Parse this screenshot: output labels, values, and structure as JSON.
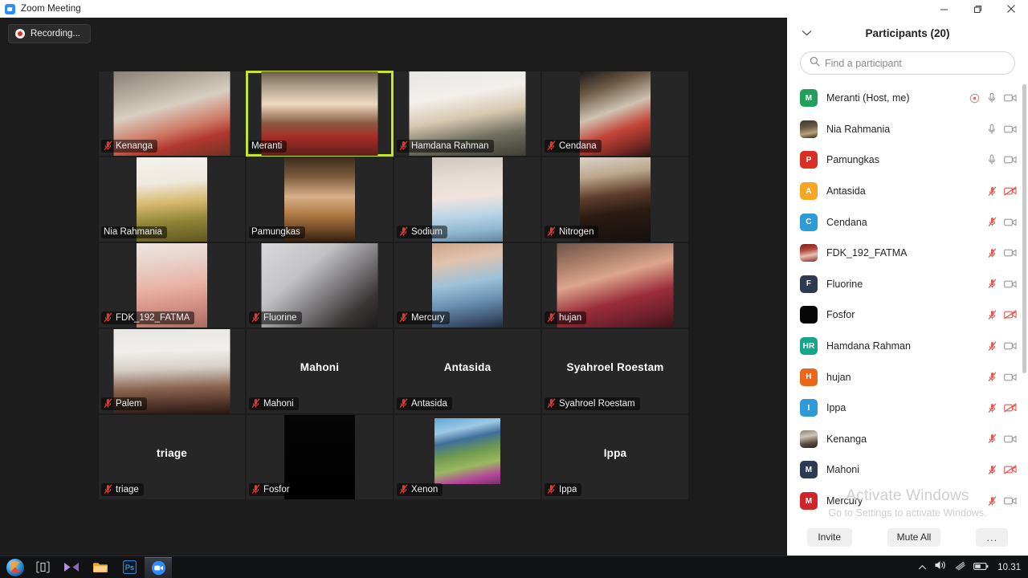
{
  "titlebar": {
    "app_icon": "zoom-icon",
    "title": "Zoom Meeting",
    "minimize": "minimize-icon",
    "restore": "restore-icon",
    "close": "close-icon"
  },
  "meeting": {
    "recording_label": "Recording...",
    "active_speaker": "Meranti",
    "active_border_color": "#c8e629",
    "tiles": [
      {
        "name": "Kenanga",
        "muted": true,
        "video": true,
        "fill": "f-kenanga",
        "media": "wide",
        "label_center": false
      },
      {
        "name": "Meranti",
        "muted": false,
        "video": true,
        "fill": "f-meranti",
        "media": "full",
        "label_center": false,
        "active": true
      },
      {
        "name": "Hamdana Rahman",
        "muted": true,
        "video": true,
        "fill": "f-hamdana",
        "media": "wide",
        "label_center": false
      },
      {
        "name": "Cendana",
        "muted": true,
        "video": true,
        "fill": "f-cendana",
        "media": "normal",
        "label_center": false
      },
      {
        "name": "Nia Rahmania",
        "muted": false,
        "video": true,
        "fill": "f-nia",
        "media": "normal",
        "label_center": false
      },
      {
        "name": "Pamungkas",
        "muted": false,
        "video": true,
        "fill": "f-pamungkas",
        "media": "normal",
        "label_center": false
      },
      {
        "name": "Sodium",
        "muted": true,
        "video": true,
        "fill": "f-sodium",
        "media": "normal",
        "label_center": false
      },
      {
        "name": "Nitrogen",
        "muted": true,
        "video": true,
        "fill": "f-nitrogen",
        "media": "normal",
        "label_center": false
      },
      {
        "name": "FDK_192_FATMA",
        "muted": true,
        "video": true,
        "fill": "f-fatma",
        "media": "normal",
        "label_center": false
      },
      {
        "name": "Fluorine",
        "muted": true,
        "video": true,
        "fill": "f-fluorine",
        "media": "wide",
        "label_center": false
      },
      {
        "name": "Mercury",
        "muted": true,
        "video": true,
        "fill": "f-mercury",
        "media": "normal",
        "label_center": false
      },
      {
        "name": "hujan",
        "muted": true,
        "video": true,
        "fill": "f-hujan",
        "media": "wide",
        "label_center": false
      },
      {
        "name": "Palem",
        "muted": true,
        "video": true,
        "fill": "f-palem",
        "media": "wide",
        "label_center": false
      },
      {
        "name": "Mahoni",
        "muted": true,
        "video": false,
        "fill": "",
        "media": "none",
        "label_center": true
      },
      {
        "name": "Antasida",
        "muted": true,
        "video": false,
        "fill": "",
        "media": "none",
        "label_center": true
      },
      {
        "name": "Syahroel Roestam",
        "muted": true,
        "video": false,
        "fill": "",
        "media": "none",
        "label_center": true
      },
      {
        "name": "triage",
        "muted": true,
        "video": false,
        "fill": "",
        "media": "none",
        "label_center": true
      },
      {
        "name": "Fosfor",
        "muted": true,
        "video": true,
        "fill": "f-fosfor",
        "media": "normal",
        "label_center": false
      },
      {
        "name": "Xenon",
        "muted": true,
        "video": true,
        "fill": "f-xenon",
        "media": "photo",
        "label_center": false
      },
      {
        "name": "Ippa",
        "muted": true,
        "video": false,
        "fill": "",
        "media": "none",
        "label_center": true
      }
    ]
  },
  "panel": {
    "collapse_icon": "chevron-down-icon",
    "title": "Participants (20)",
    "search": {
      "icon": "search-icon",
      "placeholder": "Find a participant"
    },
    "participants": [
      {
        "name": "Meranti (Host, me)",
        "initials": "M",
        "color": "#22a05b",
        "photo": "",
        "host": true,
        "mic": "on",
        "cam": "on"
      },
      {
        "name": "Nia Rahmania",
        "initials": "",
        "color": "#4a4540",
        "photo": "f-nia-av",
        "host": false,
        "mic": "on",
        "cam": "on"
      },
      {
        "name": "Pamungkas",
        "initials": "P",
        "color": "#d93025",
        "photo": "",
        "host": false,
        "mic": "on",
        "cam": "on"
      },
      {
        "name": "Antasida",
        "initials": "A",
        "color": "#f5a623",
        "photo": "",
        "host": false,
        "mic": "off",
        "cam": "off"
      },
      {
        "name": "Cendana",
        "initials": "C",
        "color": "#2e9bd6",
        "photo": "",
        "host": false,
        "mic": "off",
        "cam": "on"
      },
      {
        "name": "FDK_192_FATMA",
        "initials": "",
        "color": "#8c2f2a",
        "photo": "f-fatma-av",
        "host": false,
        "mic": "off",
        "cam": "on"
      },
      {
        "name": "Fluorine",
        "initials": "F",
        "color": "#2c3a52",
        "photo": "",
        "host": false,
        "mic": "off",
        "cam": "on"
      },
      {
        "name": "Fosfor",
        "initials": "",
        "color": "#050505",
        "photo": "",
        "host": false,
        "mic": "off",
        "cam": "off"
      },
      {
        "name": "Hamdana Rahman",
        "initials": "HR",
        "color": "#17a589",
        "photo": "",
        "host": false,
        "mic": "off",
        "cam": "on"
      },
      {
        "name": "hujan",
        "initials": "H",
        "color": "#e8691b",
        "photo": "",
        "host": false,
        "mic": "off",
        "cam": "on"
      },
      {
        "name": "Ippa",
        "initials": "I",
        "color": "#2e9bd6",
        "photo": "",
        "host": false,
        "mic": "off",
        "cam": "off"
      },
      {
        "name": "Kenanga",
        "initials": "",
        "color": "#6b6158",
        "photo": "f-ken-av",
        "host": false,
        "mic": "off",
        "cam": "on"
      },
      {
        "name": "Mahoni",
        "initials": "M",
        "color": "#2c3a52",
        "photo": "",
        "host": false,
        "mic": "off",
        "cam": "off"
      },
      {
        "name": "Mercury",
        "initials": "M",
        "color": "#d0252b",
        "photo": "",
        "host": false,
        "mic": "off",
        "cam": "on"
      }
    ],
    "footer": {
      "invite": "Invite",
      "mute_all": "Mute All",
      "more": "..."
    }
  },
  "watermark": {
    "line1": "Activate Windows",
    "line2": "Go to Settings to activate Windows."
  },
  "taskbar": {
    "start": "windows-start-icon",
    "items": [
      "task-view-icon",
      "media-player-icon",
      "file-explorer-icon",
      "photoshop-icon",
      "zoom-icon"
    ],
    "photoshop_label": "Ps",
    "tray": [
      "show-hidden-icons-icon",
      "volume-icon",
      "wifi-icon",
      "battery-icon"
    ],
    "clock": "10.31"
  }
}
